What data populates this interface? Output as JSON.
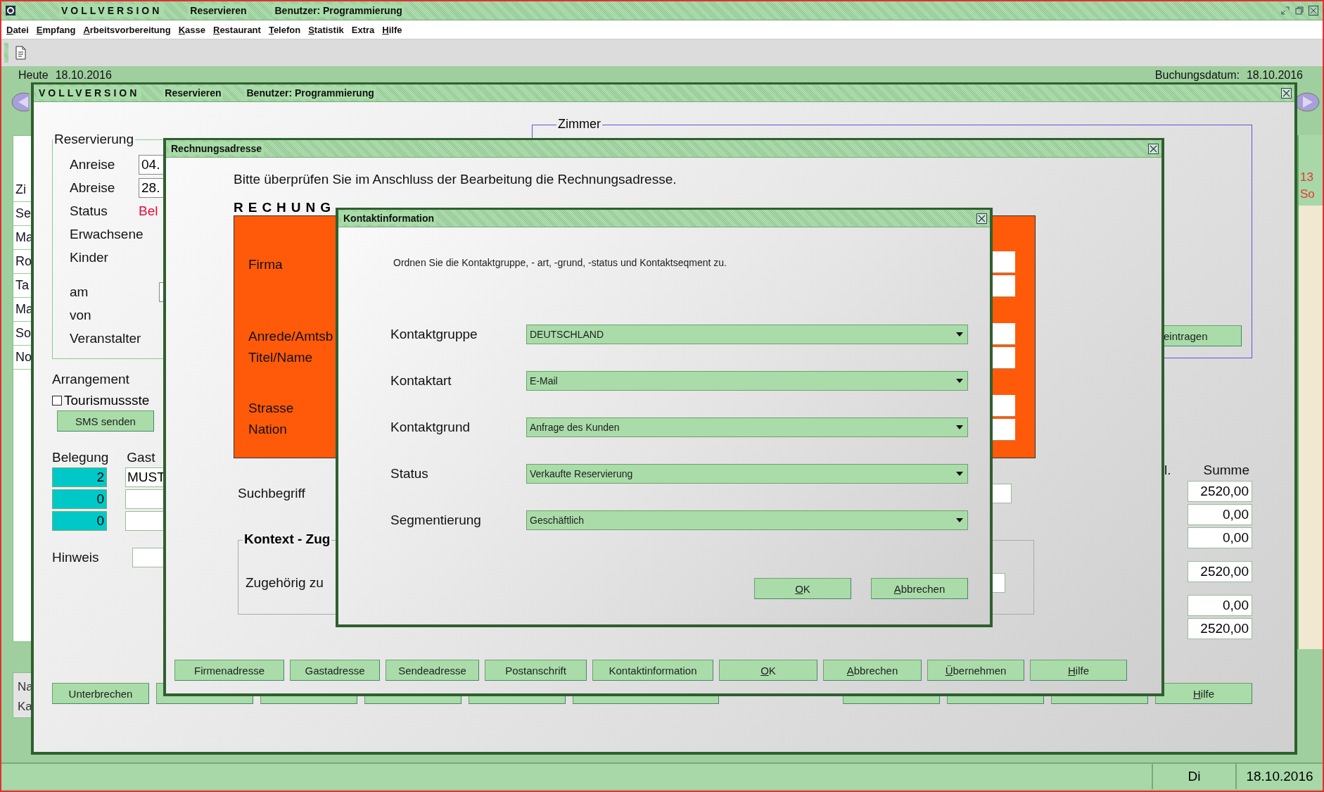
{
  "app": {
    "title": "VOLLVERSION",
    "module": "Reservieren",
    "user": "Benutzer: Programmierung"
  },
  "menu": [
    {
      "label": "Datei",
      "mnemonic": true
    },
    {
      "label": "Empfang",
      "mnemonic": true
    },
    {
      "label": "Arbeitsvorbereitung",
      "mnemonic": true
    },
    {
      "label": "Kasse",
      "mnemonic": true
    },
    {
      "label": "Restaurant",
      "mnemonic": true
    },
    {
      "label": "Telefon",
      "mnemonic": true
    },
    {
      "label": "Statistik",
      "mnemonic": true
    },
    {
      "label": "Extra",
      "mnemonic": false
    },
    {
      "label": "Hilfe",
      "mnemonic": true
    }
  ],
  "header": {
    "today_label": "Heute",
    "today": "18.10.2016",
    "booking_label": "Buchungsdatum:",
    "booking": "18.10.2016"
  },
  "left_strip": [
    "Zi",
    "Se",
    "Ma",
    "Ro",
    "Ta",
    "Ma",
    "So",
    "No"
  ],
  "left_box": [
    "Na",
    "Ka"
  ],
  "right_strip": [
    "13",
    "So"
  ],
  "reservation_window": {
    "title": "VOLLVERSION",
    "module": "Reservieren",
    "user": "Benutzer: Programmierung",
    "group": {
      "legend": "Reservierung",
      "fields": [
        {
          "label": "Anreise",
          "kind": "input",
          "value": "04."
        },
        {
          "label": "Abreise",
          "kind": "input",
          "value": "28."
        },
        {
          "label": "Status",
          "kind": "status",
          "value": "Bel"
        },
        {
          "label": "Erwachsene",
          "kind": "plain"
        },
        {
          "label": "Kinder",
          "kind": "plain"
        },
        {
          "label": "am",
          "kind": "input"
        },
        {
          "label": "von",
          "kind": "plain"
        },
        {
          "label": "Veranstalter",
          "kind": "plain"
        }
      ]
    },
    "arrangement": "Arrangement",
    "tourism": {
      "label": "Tourismussste",
      "checked": false
    },
    "sms_button": "SMS senden",
    "occupancy": {
      "header": "Belegung",
      "guest_header": "Gast",
      "rows": [
        {
          "count": "2",
          "guest": "MUST"
        },
        {
          "count": "0"
        },
        {
          "count": "0"
        }
      ]
    },
    "hint_label": "Hinweis",
    "room_legend": "Zimmer",
    "enter_button": "eintragen",
    "sums": {
      "column_cut": "l.",
      "header": "Summe",
      "groups": [
        [
          "2520,00",
          "0,00",
          "0,00"
        ],
        [
          "2520,00"
        ],
        [
          "0,00",
          "2520,00"
        ]
      ]
    },
    "buttons_left": [
      {
        "label": "Unterbrechen",
        "mnemonic": false
      }
    ],
    "buttons_right": [
      {
        "label": "Hilfe",
        "mnemonic": true
      }
    ]
  },
  "address_window": {
    "title": "Rechnungsadresse",
    "intro": "Bitte überprüfen Sie im Anschluss der Bearbeitung die Rechnungsadresse.",
    "section": "RECHUNG",
    "groups": [
      [
        "Firma"
      ],
      [
        "Anrede/Amtsb",
        "Titel/Name"
      ],
      [
        "Strasse",
        "Nation"
      ]
    ],
    "search_label": "Suchbegriff",
    "context_legend": "Kontext - Zug",
    "context_label": "Zugehörig zu",
    "buttons": [
      {
        "label": "Firmenadresse",
        "mnemonic": false
      },
      {
        "label": "Gastadresse",
        "mnemonic": false
      },
      {
        "label": "Sendeadresse",
        "mnemonic": false
      },
      {
        "label": "Postanschrift",
        "mnemonic": false
      },
      {
        "label": "Kontaktinformation",
        "mnemonic": false
      },
      {
        "label": "OK",
        "mnemonic": true
      },
      {
        "label": "Abbrechen",
        "mnemonic": true
      },
      {
        "label": "Übernehmen",
        "mnemonic": true
      },
      {
        "label": "Hilfe",
        "mnemonic": true
      }
    ]
  },
  "contact_window": {
    "title": "Kontaktinformation",
    "intro": "Ordnen Sie die Kontaktgruppe, - art, -grund, -status und Kontaktseqment zu.",
    "fields": [
      {
        "label": "Kontaktgruppe",
        "value": "DEUTSCHLAND"
      },
      {
        "label": "Kontaktart",
        "value": "E-Mail"
      },
      {
        "label": "Kontaktgrund",
        "value": "Anfrage des Kunden"
      },
      {
        "label": "Status",
        "value": "Verkaufte Reservierung"
      },
      {
        "label": "Segmentierung",
        "value": "Geschäftlich"
      }
    ],
    "buttons": [
      {
        "label": "OK",
        "mnemonic": true
      },
      {
        "label": "Abbrechen",
        "mnemonic": true
      }
    ]
  },
  "status_bar": {
    "day": "Di",
    "date": "18.10.2016"
  }
}
